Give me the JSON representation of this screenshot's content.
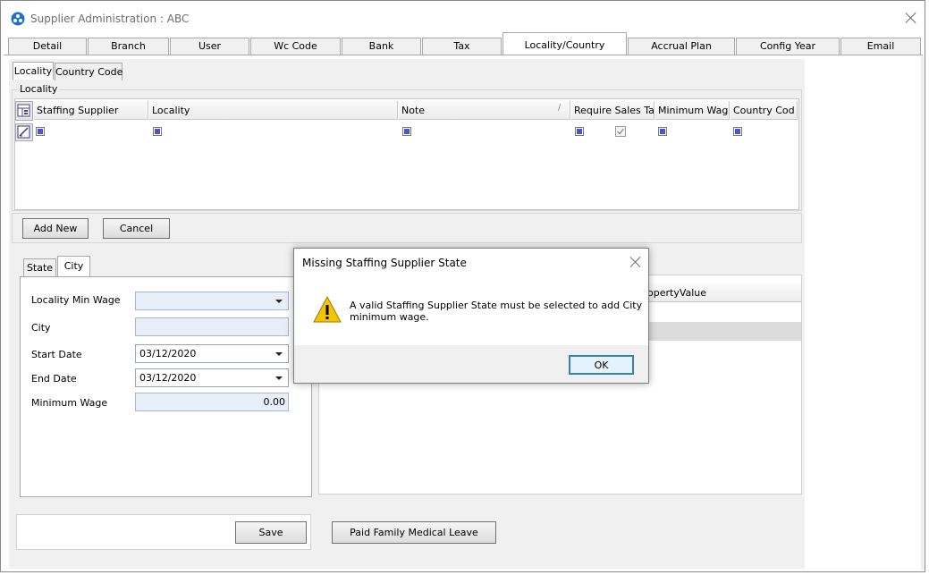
{
  "window": {
    "title": "Supplier Administration : ABC"
  },
  "tabs": [
    "Detail",
    "Branch",
    "User",
    "Wc Code",
    "Bank",
    "Tax",
    "Locality/Country",
    "Accrual Plan",
    "Config Year",
    "Email"
  ],
  "active_tab": "Locality/Country",
  "subtabs": [
    "Locality",
    "Country Code"
  ],
  "locality_group": {
    "label": "Locality",
    "columns": [
      "Staffing Supplier",
      "Locality",
      "Note",
      "Require Sales Ta",
      "Minimum Wag",
      "Country Cod"
    ],
    "sort_indicator": "/"
  },
  "buttons": {
    "add_new": "Add New",
    "cancel": "Cancel",
    "save": "Save",
    "pfml": "Paid Family Medical Leave"
  },
  "lower_tabs": [
    "State",
    "City"
  ],
  "lower_active_tab": "City",
  "city_form": {
    "locality_min_wage_label": "Locality Min Wage",
    "locality_min_wage_value": "",
    "city_label": "City",
    "city_value": "",
    "start_date_label": "Start Date",
    "start_date_value": "03/12/2020",
    "end_date_label": "End Date",
    "end_date_value": "03/12/2020",
    "minimum_wage_label": "Minimum Wage",
    "minimum_wage_value": "0.00"
  },
  "property_panel": {
    "column_header": "opertyValue"
  },
  "dialog": {
    "title": "Missing Staffing Supplier State",
    "message_line1": "A valid Staffing Supplier State must be selected to add City",
    "message_line2": "minimum wage.",
    "ok_label": "OK",
    "icon": "warning-icon"
  },
  "colors": {
    "checkbox_fill": "#5151c8",
    "field_bg": "#e8edf8",
    "panel_bg": "#f0f0f0",
    "warning": "#f5c400",
    "ok_border": "#3c7fb1"
  }
}
